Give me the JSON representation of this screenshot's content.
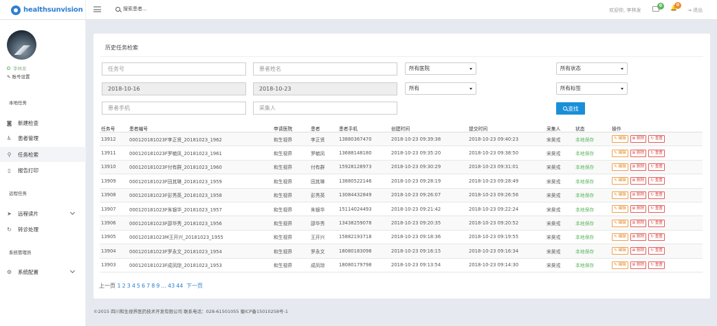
{
  "header": {
    "logo_text": "healthsunvision",
    "search_placeholder": "搜索患者...",
    "welcome": "欢迎你, 李林发",
    "mail_count": "0",
    "bell_count": "0",
    "logout": "退出",
    "badge_colors": {
      "mail": "#5fb65f",
      "bell": "#ef8a2d"
    }
  },
  "sidebar": {
    "user_name": "李林发",
    "account_settings": "账号设置",
    "section_local": "本地任务",
    "items_local": [
      {
        "label": "新建检查",
        "icon": "camera-icon"
      },
      {
        "label": "患者管理",
        "icon": "wheelchair-icon"
      },
      {
        "label": "任务检索",
        "icon": "search-icon"
      },
      {
        "label": "报告打印",
        "icon": "file-icon"
      }
    ],
    "section_remote": "远程任务",
    "items_remote": [
      {
        "label": "远程读片",
        "icon": "send-icon"
      },
      {
        "label": "转诊处理",
        "icon": "refresh-icon"
      }
    ],
    "section_admin": "系统管理员",
    "items_admin": [
      {
        "label": "系统配置",
        "icon": "gear-icon"
      }
    ]
  },
  "panel": {
    "title": "历史任务检索",
    "filters": {
      "task_no_placeholder": "任务号",
      "patient_name_placeholder": "患者姓名",
      "hospital": "所有医院",
      "status": "所有状态",
      "date_from": "2018-10-16",
      "date_to": "2018-10-23",
      "scope": "所有",
      "tag": "所有标签",
      "phone_placeholder": "患者手机",
      "collector_placeholder": "采集人"
    },
    "search_button": "查找",
    "columns": [
      "任务号",
      "患者编号",
      "申请医院",
      "患者",
      "患者手机",
      "创建时间",
      "提交时间",
      "采集人",
      "状态",
      "操作"
    ],
    "rows": [
      [
        "13912",
        "000120181023F李正贤_20181023_1962",
        "和生视界",
        "李正贤",
        "13880367470",
        "2018-10-23 09:39:38",
        "2018-10-23 09:40:23",
        "宋昊戎",
        "本地保存"
      ],
      [
        "13911",
        "000120181023F罗毓凤_20181023_1961",
        "和生视界",
        "罗毓凤",
        "13688148180",
        "2018-10-23 09:35:20",
        "2018-10-23 09:38:50",
        "宋昊戎",
        "本地保存"
      ],
      [
        "13910",
        "000120181023F付有群_20181023_1960",
        "和生视界",
        "付有群",
        "15928128973",
        "2018-10-23 09:30:29",
        "2018-10-23 09:31:01",
        "宋昊戎",
        "本地保存"
      ],
      [
        "13909",
        "000120181023F田其琳_20181023_1959",
        "和生视界",
        "田其琳",
        "13880522146",
        "2018-10-23 09:28:19",
        "2018-10-23 09:28:49",
        "宋昊戎",
        "本地保存"
      ],
      [
        "13908",
        "000120181023F彭秀英_20181023_1958",
        "和生视界",
        "彭秀英",
        "13084432849",
        "2018-10-23 09:26:07",
        "2018-10-23 09:26:56",
        "宋昊戎",
        "本地保存"
      ],
      [
        "13907",
        "000120181023F朱银华_20181023_1957",
        "和生视界",
        "朱银华",
        "15114024493",
        "2018-10-23 09:21:42",
        "2018-10-23 09:22:24",
        "宋昊戎",
        "本地保存"
      ],
      [
        "13906",
        "000120181023F邵华秀_20181023_1956",
        "和生视界",
        "邵华秀",
        "13438259078",
        "2018-10-23 09:20:35",
        "2018-10-23 09:20:52",
        "宋昊戎",
        "本地保存"
      ],
      [
        "13905",
        "000120181023M王开兴_20181023_1955",
        "和生视界",
        "王开兴",
        "15882193718",
        "2018-10-23 09:18:36",
        "2018-10-23 09:19:55",
        "宋昊戎",
        "本地保存"
      ],
      [
        "13904",
        "000120181023F罗永文_20181023_1954",
        "和生视界",
        "罗永文",
        "18080183098",
        "2018-10-23 09:16:15",
        "2018-10-23 09:16:34",
        "宋昊戎",
        "本地保存"
      ],
      [
        "13903",
        "000120181023F成凤琼_20181023_1953",
        "和生视界",
        "成凤琼",
        "18080179798",
        "2018-10-23 09:13:54",
        "2018-10-23 09:14:30",
        "宋昊戎",
        "本地保存"
      ]
    ],
    "actions": {
      "edit": "编辑",
      "delete": "删除",
      "reset": "重置"
    },
    "pager": {
      "prev": "上一页",
      "pages": [
        "1",
        "2",
        "3",
        "4",
        "5",
        "6",
        "7",
        "8",
        "9",
        "...",
        "43",
        "44"
      ],
      "next": "下一页"
    }
  },
  "footer": "©2015 四川和生视界医药技术开发有限公司 联系电话：028-61501055 蜀ICP备15010258号-1"
}
